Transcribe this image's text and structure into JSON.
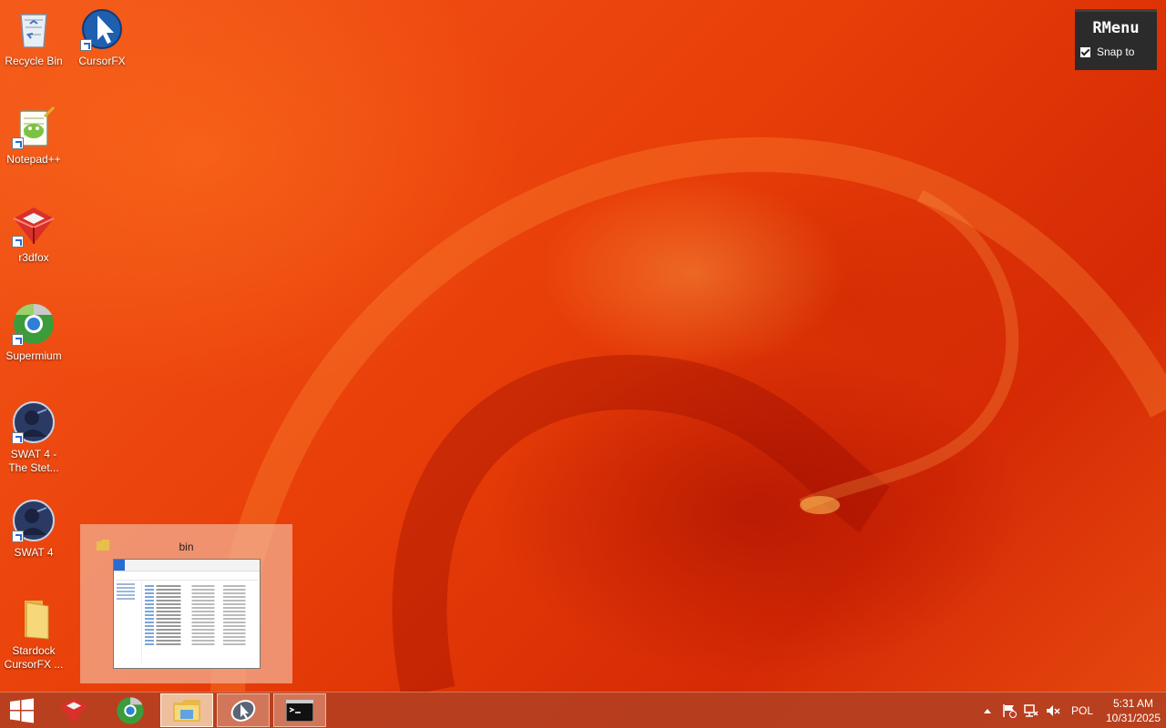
{
  "desktop_icons": [
    {
      "label": "Recycle Bin",
      "icon": "recycle-bin-icon"
    },
    {
      "label": "CursorFX",
      "icon": "cursorfx-icon"
    },
    {
      "label": "Notepad++",
      "icon": "notepadpp-icon"
    },
    {
      "label": "r3dfox",
      "icon": "r3dfox-icon"
    },
    {
      "label": "Supermium",
      "icon": "supermium-icon"
    },
    {
      "label": "SWAT 4 - The Stet...",
      "icon": "swat4-tss-icon"
    },
    {
      "label": "SWAT 4",
      "icon": "swat4-icon"
    },
    {
      "label": "Stardock CursorFX ...",
      "icon": "folder-icon"
    }
  ],
  "rmenu": {
    "title": "RMenu",
    "snap_label": "Snap to",
    "snap_checked": true
  },
  "preview": {
    "title": "bin",
    "icon": "folder-icon"
  },
  "taskbar": {
    "buttons": [
      {
        "name": "start-button",
        "icon": "windows-logo-icon"
      },
      {
        "name": "r3dfox",
        "icon": "r3dfox-icon"
      },
      {
        "name": "supermium",
        "icon": "supermium-icon"
      },
      {
        "name": "file-explorer",
        "icon": "file-explorer-icon",
        "state": "hot"
      },
      {
        "name": "cursorfx",
        "icon": "cursorfx-app-icon",
        "state": "active"
      },
      {
        "name": "command-prompt",
        "icon": "cmd-icon",
        "state": "active"
      }
    ],
    "tray": {
      "show_hidden_icon": "chevron-up-icon",
      "icons": [
        "action-center-flag-icon",
        "network-icon",
        "volume-muted-icon"
      ],
      "language": "POL",
      "time": "5:31 AM",
      "date": "10/31/2025"
    }
  },
  "colors": {
    "wallpaper_base": "#e83e08",
    "taskbar": "#b24022",
    "rmenu_bg": "#2b2b2b",
    "preview_bg": "#f3b296"
  }
}
